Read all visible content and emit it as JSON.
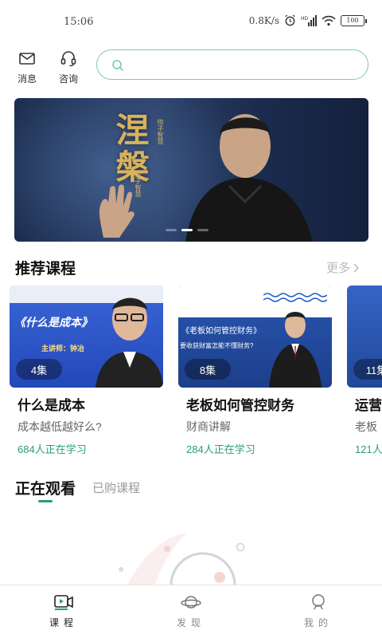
{
  "status": {
    "time": "15:06",
    "speed": "0.8K/s",
    "battery": "100"
  },
  "header": {
    "message_label": "消息",
    "consult_label": "咨询",
    "search_placeholder": ""
  },
  "banner": {
    "title": "涅槃",
    "subtitle_top": "帅子智慧",
    "subtitle_side": "涅子智慧",
    "slides": 3,
    "active_slide": 2
  },
  "recommend": {
    "title": "推荐课程",
    "more_label": "更多",
    "courses": [
      {
        "episodes": "4集",
        "title": "什么是成本",
        "subtitle": "成本越低越好么?",
        "learners": "684人正在学习",
        "thumb_title": "《什么是成本》",
        "thumb_lecturer": "主讲师：钟冶"
      },
      {
        "episodes": "8集",
        "title": "老板如何管控财务",
        "subtitle": "财商讲解",
        "learners": "284人正在学习",
        "thumb_title": "《老板如何管控财务》",
        "thumb_lecturer": "要收获财富怎能不懂财务?"
      },
      {
        "episodes": "11集",
        "title": "运营",
        "subtitle": "老板",
        "learners": "121人"
      }
    ]
  },
  "watch_tabs": {
    "active": "正在观看",
    "inactive": "已购课程"
  },
  "bottom_nav": {
    "items": [
      {
        "label": "课程",
        "icon": "video-icon",
        "active": true
      },
      {
        "label": "发现",
        "icon": "planet-icon",
        "active": false
      },
      {
        "label": "我的",
        "icon": "user-icon",
        "active": false
      }
    ]
  },
  "colors": {
    "accent": "#2a9d77",
    "search_border": "#7fc8b2"
  }
}
